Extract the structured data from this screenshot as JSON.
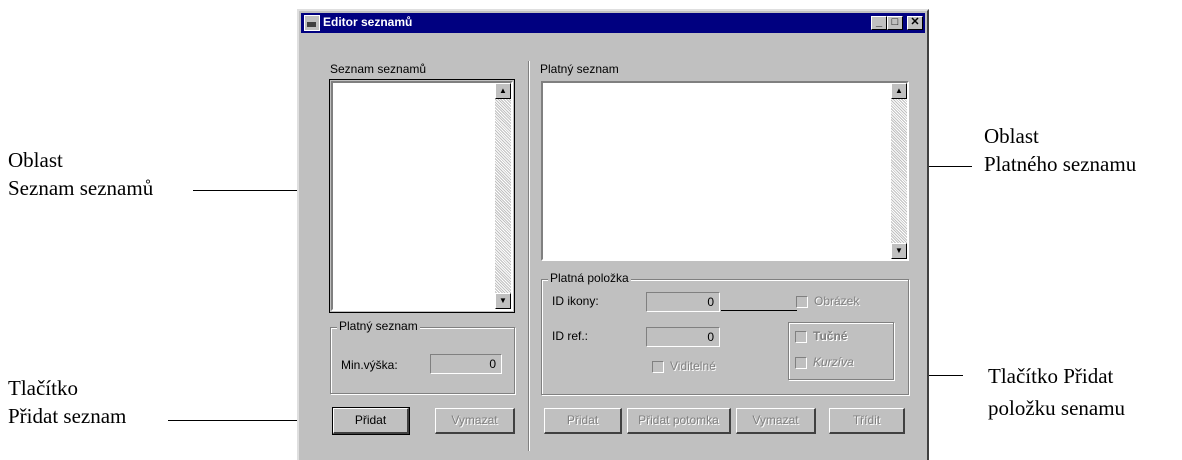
{
  "window": {
    "title": "Editor seznamů",
    "controls": [
      "_",
      "□",
      "✕"
    ]
  },
  "left": {
    "list_label": "Seznam seznamů",
    "group_title": "Platný seznam",
    "min_height_label": "Min.výška:",
    "min_height_value": "0",
    "add_button": "Přidat",
    "delete_button": "Vymazat"
  },
  "right": {
    "list_label": "Platný seznam",
    "group_title": "Platná položka",
    "icon_id_label": "ID ikony:",
    "icon_id_value": "0",
    "ref_id_label": "ID ref.:",
    "ref_id_value": "0",
    "image_label": "Obrázek",
    "bold_label": "Tučné",
    "italic_label": "Kurzíva",
    "visible_label": "Viditelné",
    "add_button": "Přidat",
    "add_child_button": "Přidat potomka",
    "delete_button": "Vymazat",
    "sort_button": "Třídit"
  },
  "annotations": {
    "list_area_line1": "Oblast",
    "list_area_line2": "Seznam seznamů",
    "current_area_line1": "Oblast",
    "current_area_line2": "Platného  seznamu",
    "add_list_line1": "Tlačítko",
    "add_list_line2": "Přidat seznam",
    "add_item_line1": "Tlačítko Přidat",
    "add_item_line2": "položku senamu"
  }
}
